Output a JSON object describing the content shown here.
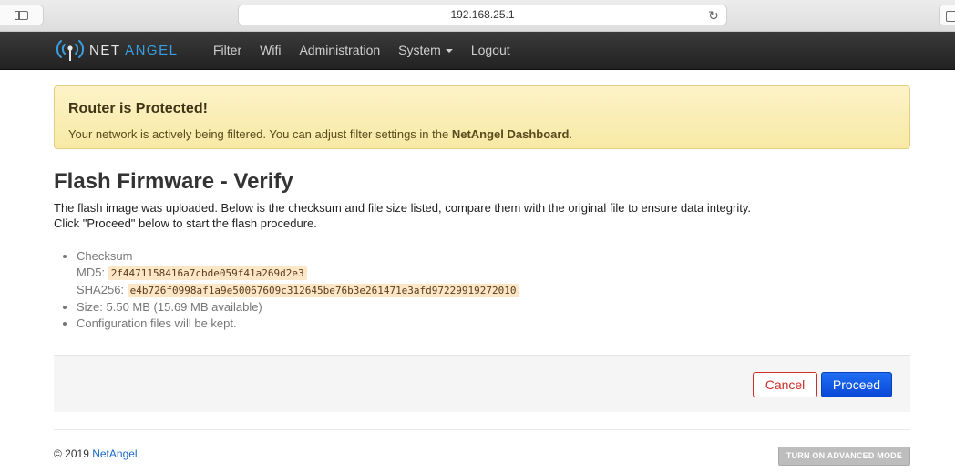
{
  "browser": {
    "url": "192.168.25.1",
    "reload_icon": "reload-icon",
    "sidebar_icon": "sidebar-icon"
  },
  "navbar": {
    "brand_prefix": "NET",
    "brand_suffix": "ANGEL",
    "logo_icon": "wifi-antenna-icon",
    "items": [
      {
        "label": "Filter"
      },
      {
        "label": "Wifi"
      },
      {
        "label": "Administration"
      },
      {
        "label": "System"
      },
      {
        "label": "Logout"
      }
    ]
  },
  "alert": {
    "title": "Router is Protected!",
    "text_before": "Your network is actively being filtered. You can adjust filter settings in the ",
    "text_bold": "NetAngel Dashboard",
    "text_after": "."
  },
  "main": {
    "title": "Flash Firmware - Verify",
    "description_line1": "The flash image was uploaded. Below is the checksum and file size listed, compare them with the original file to ensure data integrity.",
    "description_line2": "Click \"Proceed\" below to start the flash procedure.",
    "checksum_label": "Checksum",
    "md5_label": "MD5:",
    "md5_value": "2f4471158416a7cbde059f41a269d2e3",
    "sha256_label": "SHA256:",
    "sha256_value": "e4b726f0998af1a9e50067609c312645be76b3e261471e3afd97229919272010",
    "size_text": "Size: 5.50 MB (15.69 MB available)",
    "config_text": "Configuration files will be kept."
  },
  "actions": {
    "cancel_label": "Cancel",
    "proceed_label": "Proceed"
  },
  "footer": {
    "copyright_prefix": "© 2019 ",
    "copyright_link": "NetAngel",
    "advanced_mode_label": "TURN ON ADVANCED MODE"
  },
  "colors": {
    "navbar_bg": "#2b2b2b",
    "alert_bg": "#f8e9a4",
    "accent_blue": "#0a48d6",
    "cancel_red": "#c9302c",
    "hash_highlight": "#fbe6c6"
  }
}
